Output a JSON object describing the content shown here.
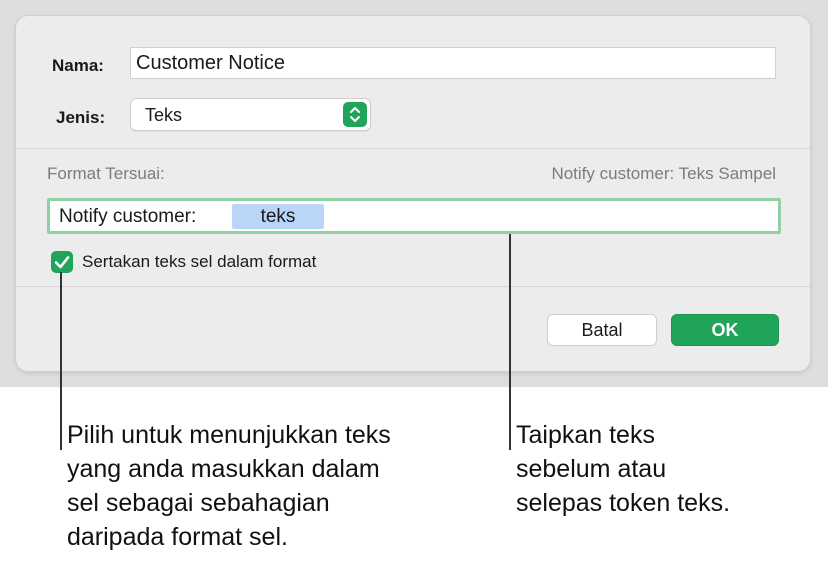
{
  "dialog": {
    "name_label": "Nama:",
    "name_value": "Customer Notice",
    "type_label": "Jenis:",
    "type_value": "Teks",
    "custom_format_label": "Format Tersuai:",
    "preview_text": "Notify customer: Teks Sampel",
    "format_prefix": "Notify customer:",
    "format_token": "teks",
    "include_checkbox_label": "Sertakan teks sel dalam format",
    "include_checked": true,
    "cancel_label": "Batal",
    "ok_label": "OK"
  },
  "callouts": {
    "left": [
      "Pilih untuk menunjukkan teks",
      "yang anda masukkan dalam",
      "sel sebagai sebahagian",
      "daripada format sel."
    ],
    "right": [
      "Taipkan teks",
      "sebelum atau",
      "selepas token teks."
    ]
  },
  "colors": {
    "accent_green": "#20a45a",
    "focus_ring": "#8fd1a3",
    "token_blue": "#b9d5f7"
  }
}
